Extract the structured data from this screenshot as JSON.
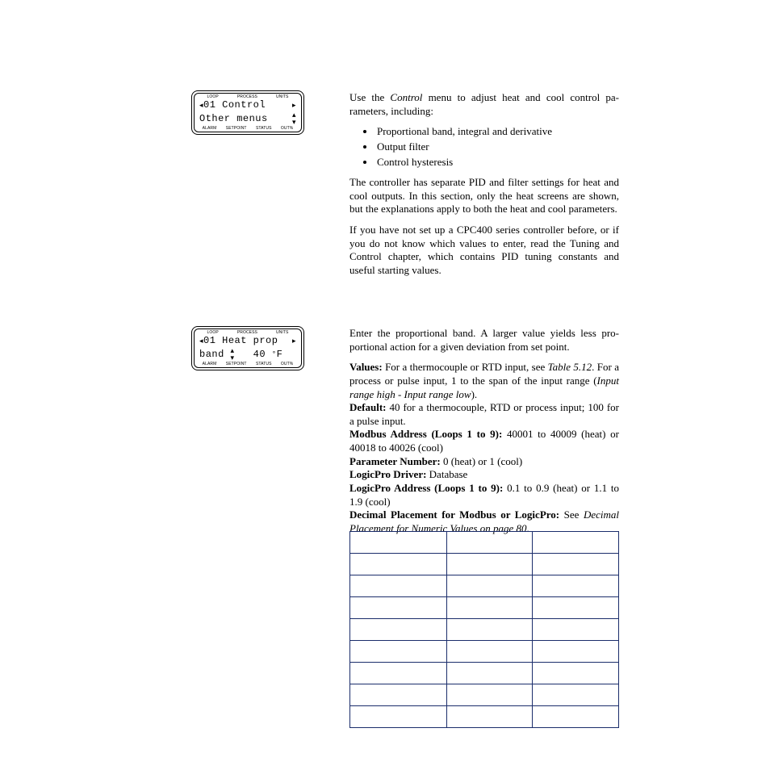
{
  "lcd1": {
    "top": [
      "LOOP",
      "PROCESS",
      "UNITS"
    ],
    "line1_left": "◂",
    "line1_text": "01 Control",
    "line1_right": "▸",
    "line2_text": "Other menus",
    "line2_right_a": "▴",
    "line2_right_b": "▾",
    "bottom": [
      "ALARM",
      "SETPOINT",
      "STATUS",
      "OUT%"
    ]
  },
  "lcd2": {
    "top": [
      "LOOP",
      "PROCESS",
      "UNITS"
    ],
    "line1_left": "◂",
    "line1_text": "01 Heat prop",
    "line1_right": "▸",
    "line2_text": "band ",
    "line2_mid_a": "▴",
    "line2_mid_b": "▾",
    "line2_val": "   40 ",
    "line2_deg": "°",
    "line2_unit": "F",
    "bottom": [
      "ALARM",
      "SETPOINT",
      "STATUS",
      "OUT%"
    ]
  },
  "txt": {
    "p1a": "Use the ",
    "p1b": "Control",
    "p1c": " menu to adjust heat and cool control pa­rameters, including:",
    "b1": "Proportional band, integral and derivative",
    "b2": "Output filter",
    "b3": "Control hysteresis",
    "p2": "The controller has separate PID and filter settings for heat and cool outputs. In this section, only the heat screens are shown, but the explanations apply to both the heat and cool parameters.",
    "p3": "If you have not set up a CPC400 series controller before, or if you do not know which values to enter, read the Tuning and Control chapter, which contains PID tuning constants and useful starting values.",
    "pp1": "Enter the proportional band. A larger value yields less pro­portional action for a given deviation from set point.",
    "vL": "Values:",
    "vTa": " For a thermocouple or RTD input, see ",
    "vTb": "Table 5.12",
    "vTc": ". For a process or pulse input, 1 to the span of the input range (",
    "vTd": "Input range high - Input range low",
    "vTe": ").",
    "dL": "Default:",
    "dT": " 40 for a thermocouple, RTD or process input; 100 for a pulse input.",
    "mL": "Modbus Address (Loops 1 to 9):",
    "mT": " 40001 to 40009 (heat) or 40018 to 40026 (cool)",
    "pnL": "Parameter Number:",
    "pnT": " 0 (heat) or 1 (cool)",
    "ldL": "LogicPro Driver:",
    "ldT": " Database",
    "laL": "LogicPro Address (Loops 1 to 9):",
    "laT": " 0.1 to 0.9 (heat) or 1.1 to 1.9 (cool)",
    "dpL": "Decimal Placement for Modbus or LogicPro:",
    "dpTa": " See ",
    "dpTb": "Dec­imal Placement for Numeric Values on page 80",
    "dpTc": "."
  }
}
